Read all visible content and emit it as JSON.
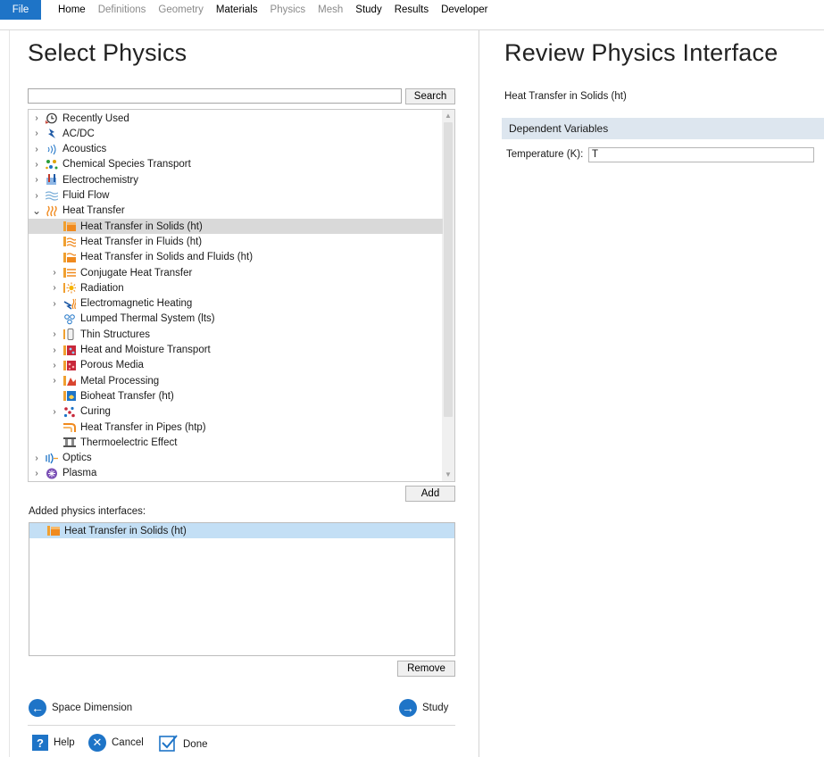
{
  "menubar": {
    "file": "File",
    "tabs": [
      {
        "label": "Home",
        "enabled": true
      },
      {
        "label": "Definitions",
        "enabled": false
      },
      {
        "label": "Geometry",
        "enabled": false
      },
      {
        "label": "Materials",
        "enabled": true
      },
      {
        "label": "Physics",
        "enabled": false
      },
      {
        "label": "Mesh",
        "enabled": false
      },
      {
        "label": "Study",
        "enabled": true
      },
      {
        "label": "Results",
        "enabled": true
      },
      {
        "label": "Developer",
        "enabled": true
      }
    ]
  },
  "left": {
    "title": "Select Physics",
    "search": {
      "value": "",
      "button": "Search"
    },
    "tree": [
      {
        "label": "Recently Used",
        "expand": "collapsed",
        "icon": "clock-icon",
        "indent": 0
      },
      {
        "label": "AC/DC",
        "expand": "collapsed",
        "icon": "lightning-icon",
        "indent": 0
      },
      {
        "label": "Acoustics",
        "expand": "collapsed",
        "icon": "sound-waves-icon",
        "indent": 0
      },
      {
        "label": "Chemical Species Transport",
        "expand": "collapsed",
        "icon": "molecules-icon",
        "indent": 0
      },
      {
        "label": "Electrochemistry",
        "expand": "collapsed",
        "icon": "electrochemistry-icon",
        "indent": 0
      },
      {
        "label": "Fluid Flow",
        "expand": "collapsed",
        "icon": "flow-icon",
        "indent": 0
      },
      {
        "label": "Heat Transfer",
        "expand": "expanded",
        "icon": "heat-icon",
        "indent": 0
      },
      {
        "label": "Heat Transfer in Solids (ht)",
        "expand": "none",
        "icon": "solid-block-icon",
        "indent": 1,
        "selected": true
      },
      {
        "label": "Heat Transfer in Fluids (ht)",
        "expand": "none",
        "icon": "fluid-heat-icon",
        "indent": 1
      },
      {
        "label": "Heat Transfer in Solids and Fluids (ht)",
        "expand": "none",
        "icon": "solid-fluid-heat-icon",
        "indent": 1
      },
      {
        "label": "Conjugate Heat Transfer",
        "expand": "collapsed",
        "icon": "conjugate-heat-icon",
        "indent": 1
      },
      {
        "label": "Radiation",
        "expand": "collapsed",
        "icon": "radiation-sun-icon",
        "indent": 1
      },
      {
        "label": "Electromagnetic Heating",
        "expand": "collapsed",
        "icon": "em-heating-icon",
        "indent": 1
      },
      {
        "label": "Lumped Thermal System (lts)",
        "expand": "none",
        "icon": "lumped-system-icon",
        "indent": 1
      },
      {
        "label": "Thin Structures",
        "expand": "collapsed",
        "icon": "thin-structure-icon",
        "indent": 1
      },
      {
        "label": "Heat and Moisture Transport",
        "expand": "collapsed",
        "icon": "moisture-icon",
        "indent": 1
      },
      {
        "label": "Porous Media",
        "expand": "collapsed",
        "icon": "porous-icon",
        "indent": 1
      },
      {
        "label": "Metal Processing",
        "expand": "collapsed",
        "icon": "metal-icon",
        "indent": 1
      },
      {
        "label": "Bioheat Transfer (ht)",
        "expand": "none",
        "icon": "bioheat-icon",
        "indent": 1
      },
      {
        "label": "Curing",
        "expand": "collapsed",
        "icon": "curing-icon",
        "indent": 1
      },
      {
        "label": "Heat Transfer in Pipes (htp)",
        "expand": "none",
        "icon": "pipes-icon",
        "indent": 1
      },
      {
        "label": "Thermoelectric Effect",
        "expand": "none",
        "icon": "thermoelectric-icon",
        "indent": 1
      },
      {
        "label": "Optics",
        "expand": "collapsed",
        "icon": "optics-icon",
        "indent": 0
      },
      {
        "label": "Plasma",
        "expand": "collapsed",
        "icon": "plasma-icon",
        "indent": 0
      }
    ],
    "add_button": "Add",
    "added_label": "Added physics interfaces:",
    "added": [
      {
        "label": "Heat Transfer in Solids (ht)",
        "icon": "solid-block-icon"
      }
    ],
    "remove_button": "Remove",
    "back_label": "Space Dimension",
    "next_label": "Study",
    "help_label": "Help",
    "cancel_label": "Cancel",
    "done_label": "Done"
  },
  "right": {
    "title": "Review Physics Interface",
    "interface_name": "Heat Transfer in Solids (ht)",
    "section": "Dependent Variables",
    "temp_label": "Temperature (K):",
    "temp_value": "T"
  },
  "colors": {
    "accent": "#1e74c7",
    "selected_row": "#d9d9d9",
    "added_row": "#c3dff5",
    "section_bar": "#dde6ef"
  }
}
